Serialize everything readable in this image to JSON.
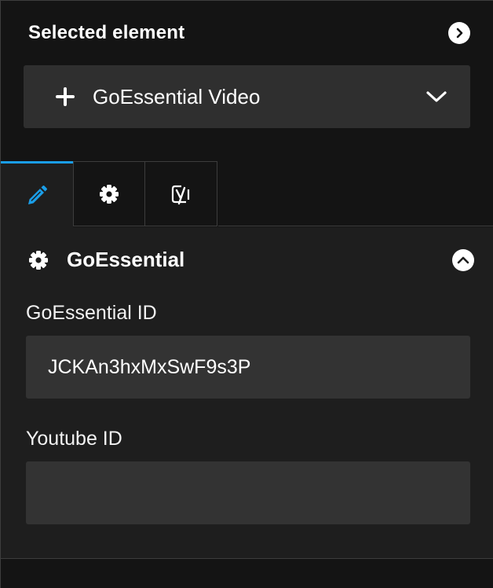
{
  "selected": {
    "title": "Selected element",
    "next_icon": "chevron-right-circle-icon",
    "dropdown": {
      "icon": "plus-icon",
      "label": "GoEssential Video",
      "caret_icon": "chevron-down-icon"
    }
  },
  "tabs": [
    {
      "name": "edit",
      "icon": "pencil-icon",
      "active": true
    },
    {
      "name": "settings",
      "icon": "gear-icon",
      "active": false
    },
    {
      "name": "seo",
      "icon": "yoast-icon",
      "active": false
    }
  ],
  "section": {
    "icon": "gear-icon",
    "title": "GoEssential",
    "collapse_icon": "chevron-up-circle-icon"
  },
  "fields": {
    "goessential_id": {
      "label": "GoEssential ID",
      "value": "JCKAn3hxMxSwF9s3P",
      "placeholder": ""
    },
    "youtube_id": {
      "label": "Youtube ID",
      "value": "",
      "placeholder": ""
    }
  },
  "colors": {
    "accent": "#1a9ee8",
    "panel_bg": "#1e1e1e",
    "field_bg": "#333333"
  }
}
